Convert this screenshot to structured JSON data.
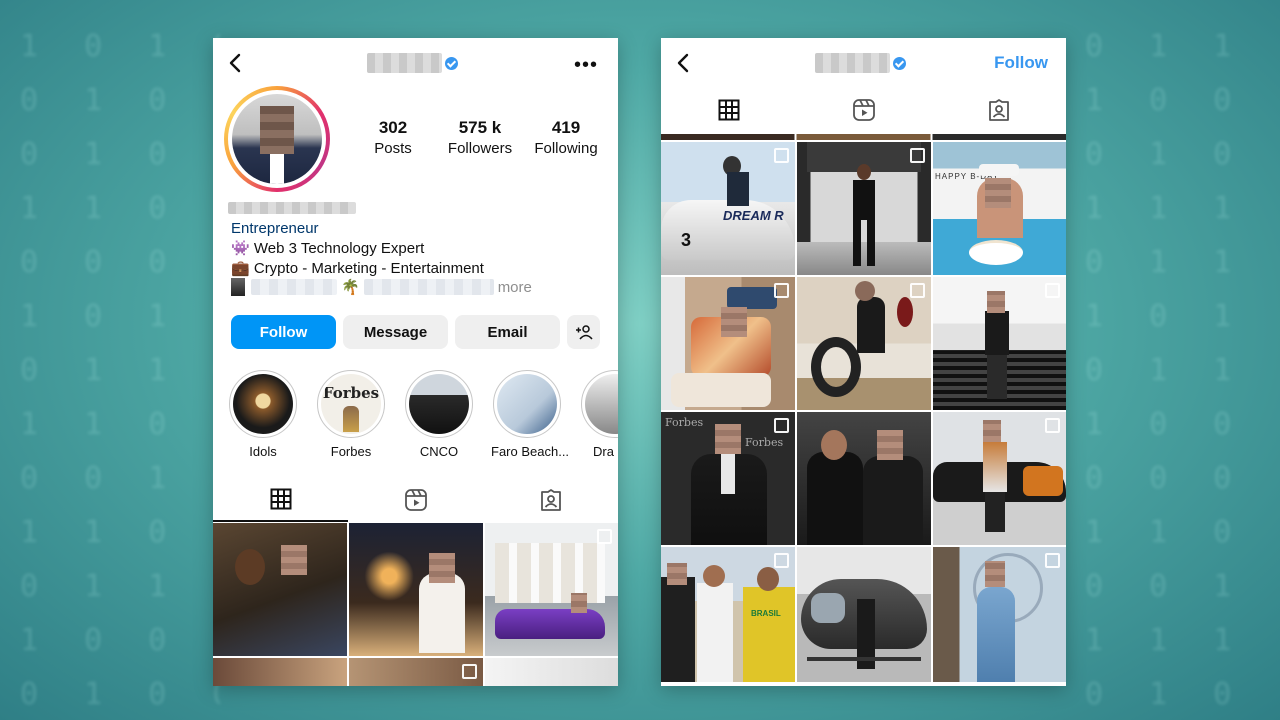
{
  "left_profile": {
    "stats": [
      {
        "number": "302",
        "label": "Posts"
      },
      {
        "number": "575 k",
        "label": "Followers"
      },
      {
        "number": "419",
        "label": "Following"
      }
    ],
    "bio": {
      "category": "Entrepreneur",
      "line1_emoji": "👾",
      "line1_text": "Web 3 Technology Expert",
      "line2_emoji": "💼",
      "line2_text": "Crypto - Marketing - Entertainment",
      "line3_emoji": "🌴",
      "more_label": "more"
    },
    "buttons": {
      "follow": "Follow",
      "message": "Message",
      "email": "Email"
    },
    "highlights": [
      {
        "label": "Idols"
      },
      {
        "label": "Forbes",
        "image_text": "Forbes"
      },
      {
        "label": "CNCO"
      },
      {
        "label": "Faro Beach..."
      },
      {
        "label": "Dra"
      }
    ]
  },
  "right_profile": {
    "follow_label": "Follow"
  },
  "post_text": {
    "dream_car": "DREAM R",
    "car_number": "3",
    "happy_bday": "HAPPY B-DAY",
    "forbes": "Forbes",
    "brasil": "BRASIL"
  },
  "colors": {
    "accent_blue": "#3897f0",
    "follow_button_bg": "#0095f6",
    "secondary_button_bg": "#efefef",
    "category_text": "#00376b"
  },
  "icons": [
    "back-arrow-icon",
    "verified-badge-icon",
    "more-options-icon",
    "add-person-icon",
    "grid-tab-icon",
    "reels-tab-icon",
    "tagged-tab-icon",
    "multi-image-icon"
  ]
}
